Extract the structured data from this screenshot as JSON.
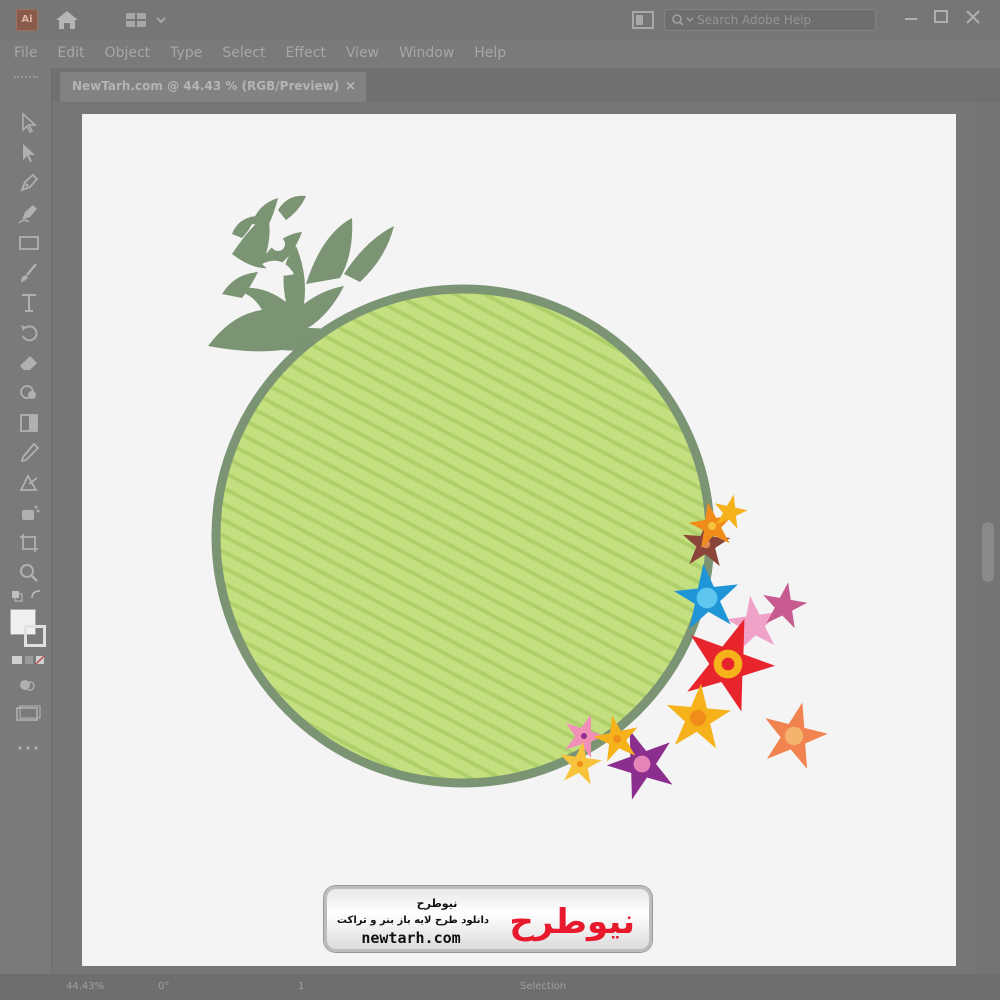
{
  "app": {
    "logo_text": "Ai",
    "search_placeholder": "Search Adobe Help"
  },
  "menu": [
    "File",
    "Edit",
    "Object",
    "Type",
    "Select",
    "Effect",
    "View",
    "Window",
    "Help"
  ],
  "document_tab": {
    "title": "NewTarh.com @ 44.43 % (RGB/Preview)",
    "close_glyph": "×"
  },
  "artwork": {
    "circle_fill": "#c3df7f",
    "circle_stroke": "#7b9473",
    "ornament_color": "#7b9473"
  },
  "watermark": {
    "brand_fa": "نیوطرح",
    "line1": "نیوطرح",
    "line2": "دانلود طرح لایه باز بنر و تراکت",
    "url": "newtarh.com",
    "accent": "#e8192c"
  },
  "status": {
    "zoom": "44.43%",
    "rotation": "0°",
    "artboard_nav": "1",
    "tool_label": "Selection"
  }
}
